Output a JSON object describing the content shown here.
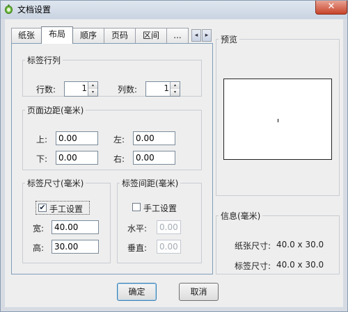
{
  "window": {
    "title": "文档设置",
    "close_label": "✕"
  },
  "tabs": [
    {
      "label": "纸张",
      "active": false
    },
    {
      "label": "布局",
      "active": true
    },
    {
      "label": "顺序",
      "active": false
    },
    {
      "label": "页码",
      "active": false
    },
    {
      "label": "区间",
      "active": false
    },
    {
      "label": "...",
      "active": false
    }
  ],
  "tab_scroll": {
    "left": "◂",
    "right": "▸"
  },
  "rows_cols": {
    "legend": "标签行列",
    "rows_label": "行数:",
    "rows_value": "1",
    "cols_label": "列数:",
    "cols_value": "1",
    "spin_up": "▴",
    "spin_down": "▾"
  },
  "margins": {
    "legend": "页面边距(毫米)",
    "top_label": "上:",
    "top_value": "0.00",
    "left_label": "左:",
    "left_value": "0.00",
    "bottom_label": "下:",
    "bottom_value": "0.00",
    "right_label": "右:",
    "right_value": "0.00"
  },
  "label_size": {
    "legend": "标签尺寸(毫米)",
    "manual_label": "手工设置",
    "manual_checked": true,
    "check_mark": "✔",
    "width_label": "宽:",
    "width_value": "40.00",
    "height_label": "高:",
    "height_value": "30.00"
  },
  "label_gap": {
    "legend": "标签间距(毫米)",
    "manual_label": "手工设置",
    "manual_checked": false,
    "h_label": "水平:",
    "h_value": "0.00",
    "v_label": "垂直:",
    "v_value": "0.00"
  },
  "preview": {
    "legend": "预览"
  },
  "info": {
    "legend": "信息(毫米)",
    "paper_label": "纸张尺寸:",
    "paper_value": "40.0 x 30.0",
    "label_label": "标签尺寸:",
    "label_value": "40.0 x 30.0"
  },
  "buttons": {
    "ok": "确定",
    "cancel": "取消"
  },
  "colors": {
    "accent": "#3c7fb1",
    "close": "#c7432a",
    "title_bar": "#c9d4e2"
  }
}
